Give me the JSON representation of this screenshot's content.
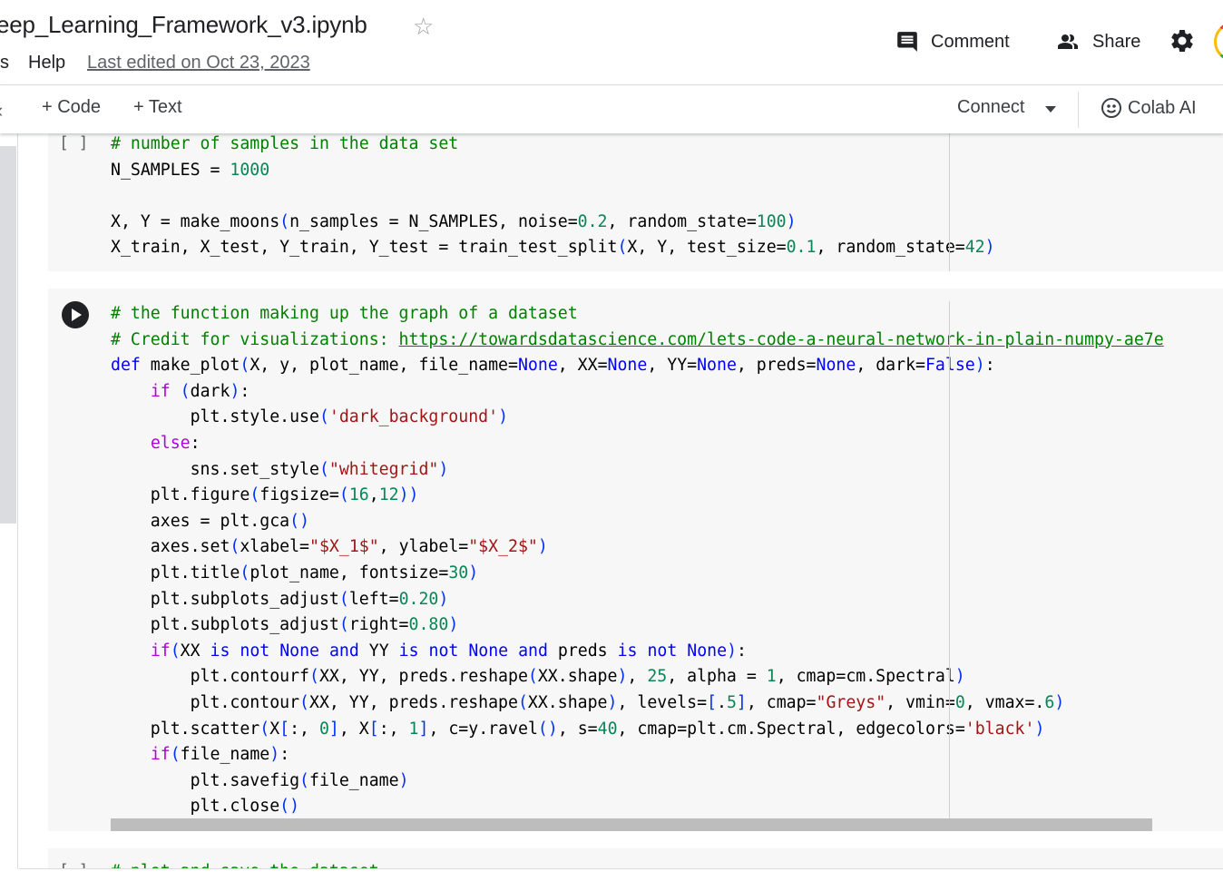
{
  "header": {
    "title": "eep_Learning_Framework_v3.ipynb",
    "menu_tail": "s",
    "help_label": "Help",
    "last_edited": "Last edited on Oct 23, 2023",
    "comment_label": "Comment",
    "share_label": "Share"
  },
  "toolbar": {
    "add_code_label": "+ Code",
    "add_text_label": "+ Text",
    "connect_label": "Connect",
    "colab_ai_label": "Colab AI"
  },
  "cells": [
    {
      "exec_count": "[ ]",
      "lines": [
        "# number of samples in the data set",
        "N_SAMPLES = 1000",
        "",
        "X, Y = make_moons(n_samples = N_SAMPLES, noise=0.2, random_state=100)",
        "X_train, X_test, Y_train, Y_test = train_test_split(X, Y, test_size=0.1, random_state=42)"
      ]
    },
    {
      "exec_count": "",
      "lines": [
        "# the function making up the graph of a dataset",
        "# Credit for visualizations: https://towardsdatascience.com/lets-code-a-neural-network-in-plain-numpy-ae7e",
        "def make_plot(X, y, plot_name, file_name=None, XX=None, YY=None, preds=None, dark=False):",
        "    if (dark):",
        "        plt.style.use('dark_background')",
        "    else:",
        "        sns.set_style(\"whitegrid\")",
        "    plt.figure(figsize=(16,12))",
        "    axes = plt.gca()",
        "    axes.set(xlabel=\"$X_1$\", ylabel=\"$X_2$\")",
        "    plt.title(plot_name, fontsize=30)",
        "    plt.subplots_adjust(left=0.20)",
        "    plt.subplots_adjust(right=0.80)",
        "    if(XX is not None and YY is not None and preds is not None):",
        "        plt.contourf(XX, YY, preds.reshape(XX.shape), 25, alpha = 1, cmap=cm.Spectral)",
        "        plt.contour(XX, YY, preds.reshape(XX.shape), levels=[.5], cmap=\"Greys\", vmin=0, vmax=.6)",
        "    plt.scatter(X[:, 0], X[:, 1], c=y.ravel(), s=40, cmap=plt.cm.Spectral, edgecolors='black')",
        "    if(file_name):",
        "        plt.savefig(file_name)",
        "        plt.close()"
      ]
    },
    {
      "exec_count": "[ ]",
      "lines": [
        "# plot and save the dataset"
      ]
    }
  ],
  "colors": {
    "comment": "#008000",
    "keyword": "#0000ff",
    "number": "#098658",
    "string": "#a31515",
    "cell_bg": "#f7f7f7"
  },
  "icons": [
    "star-icon",
    "comment-icon",
    "share-people-icon",
    "gear-icon",
    "account-avatar",
    "collapse-sidebar-icon",
    "connect-dropdown-icon",
    "colab-ai-icon",
    "run-cell-icon"
  ]
}
